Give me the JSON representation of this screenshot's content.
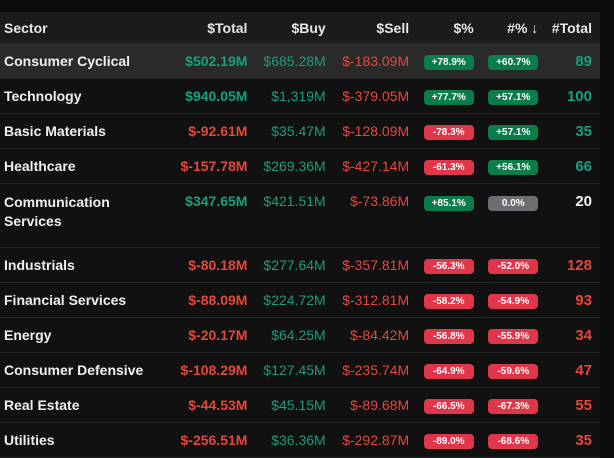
{
  "headers": {
    "sector": "Sector",
    "total": "$Total",
    "buy": "$Buy",
    "sell": "$Sell",
    "pct_dollar": "$%",
    "pct_count": "#% ↓",
    "count": "#Total"
  },
  "colors": {
    "green": "#17a07e",
    "red": "#e4483c",
    "badge_green": "#0b7d4a",
    "badge_red": "#e0364a",
    "badge_neutral": "#6b6f73"
  },
  "rows": [
    {
      "sector": "Consumer Cyclical",
      "total": "$502.19M",
      "buy": "$685.28M",
      "sell": "$-183.09M",
      "pct_dollar": "+78.9%",
      "pct_count": "+60.7%",
      "count": "89"
    },
    {
      "sector": "Technology",
      "total": "$940.05M",
      "buy": "$1,319M",
      "sell": "$-379.05M",
      "pct_dollar": "+77.7%",
      "pct_count": "+57.1%",
      "count": "100"
    },
    {
      "sector": "Basic Materials",
      "total": "$-92.61M",
      "buy": "$35.47M",
      "sell": "$-128.09M",
      "pct_dollar": "-78.3%",
      "pct_count": "+57.1%",
      "count": "35"
    },
    {
      "sector": "Healthcare",
      "total": "$-157.78M",
      "buy": "$269.36M",
      "sell": "$-427.14M",
      "pct_dollar": "-61.3%",
      "pct_count": "+56.1%",
      "count": "66"
    },
    {
      "sector": "Communication Services",
      "total": "$347.65M",
      "buy": "$421.51M",
      "sell": "$-73.86M",
      "pct_dollar": "+85.1%",
      "pct_count": "0.0%",
      "count": "20"
    },
    {
      "sector": "Industrials",
      "total": "$-80.18M",
      "buy": "$277.64M",
      "sell": "$-357.81M",
      "pct_dollar": "-56.3%",
      "pct_count": "-52.0%",
      "count": "128"
    },
    {
      "sector": "Financial Services",
      "total": "$-88.09M",
      "buy": "$224.72M",
      "sell": "$-312.81M",
      "pct_dollar": "-58.2%",
      "pct_count": "-54.9%",
      "count": "93"
    },
    {
      "sector": "Energy",
      "total": "$-20.17M",
      "buy": "$64.25M",
      "sell": "$-84.42M",
      "pct_dollar": "-56.8%",
      "pct_count": "-55.9%",
      "count": "34"
    },
    {
      "sector": "Consumer Defensive",
      "total": "$-108.29M",
      "buy": "$127.45M",
      "sell": "$-235.74M",
      "pct_dollar": "-64.9%",
      "pct_count": "-59.6%",
      "count": "47"
    },
    {
      "sector": "Real Estate",
      "total": "$-44.53M",
      "buy": "$45.15M",
      "sell": "$-89.68M",
      "pct_dollar": "-66.5%",
      "pct_count": "-67.3%",
      "count": "55"
    },
    {
      "sector": "Utilities",
      "total": "$-256.51M",
      "buy": "$36.36M",
      "sell": "$-292.87M",
      "pct_dollar": "-89.0%",
      "pct_count": "-68.6%",
      "count": "35"
    }
  ]
}
